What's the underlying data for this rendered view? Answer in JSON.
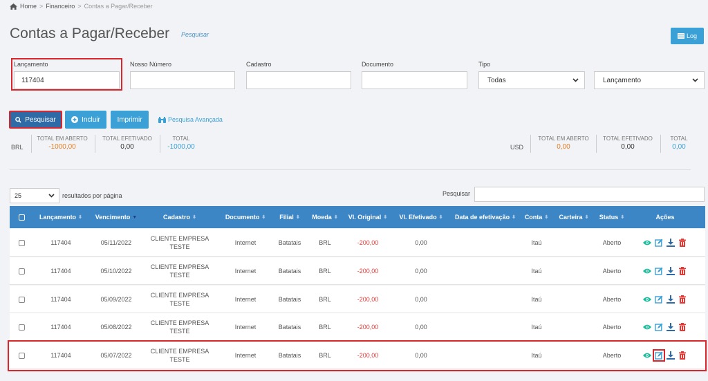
{
  "breadcrumb": {
    "home": "Home",
    "sep": ">",
    "item1": "Financeiro",
    "item2": "Contas a Pagar/Receber"
  },
  "header": {
    "title": "Contas a Pagar/Receber",
    "search_link": "Pesquisar",
    "log_button": "Log"
  },
  "filters": {
    "lancamento": {
      "label": "Lançamento",
      "value": "117404"
    },
    "nosso_numero": {
      "label": "Nosso Número",
      "value": ""
    },
    "cadastro": {
      "label": "Cadastro",
      "value": ""
    },
    "documento": {
      "label": "Documento",
      "value": ""
    },
    "tipo": {
      "label": "Tipo",
      "value": "Todas"
    },
    "order": {
      "value": "Lançamento"
    }
  },
  "buttons": {
    "search": "Pesquisar",
    "incluir": "Incluir",
    "imprimir": "Imprimir",
    "advanced": "Pesquisa Avançada"
  },
  "totals": {
    "brl": {
      "currency": "BRL",
      "open_label": "TOTAL EM ABERTO",
      "open": "-1000,00",
      "done_label": "TOTAL EFETIVADO",
      "done": "0,00",
      "total_label": "TOTAL",
      "total": "-1000,00"
    },
    "usd": {
      "currency": "USD",
      "open_label": "TOTAL EM ABERTO",
      "open": "0,00",
      "done_label": "TOTAL EFETIVADO",
      "done": "0,00",
      "total_label": "TOTAL",
      "total": "0,00"
    }
  },
  "table_controls": {
    "per_page": "25",
    "per_page_label": "resultados por página",
    "search_label": "Pesquisar"
  },
  "columns": [
    "Lançamento",
    "Vencimento",
    "Cadastro",
    "Documento",
    "Filial",
    "Moeda",
    "Vl. Original",
    "Vl. Efetivado",
    "Data de efetivação",
    "Conta",
    "Carteira",
    "Status",
    "Ações"
  ],
  "rows": [
    {
      "lancamento": "117404",
      "vencimento": "05/11/2022",
      "cadastro": "CLIENTE EMPRESA TESTE",
      "documento": "Internet",
      "filial": "Batatais",
      "moeda": "BRL",
      "original": "-200,00",
      "efetivado": "0,00",
      "data": "",
      "conta": "Itaú",
      "carteira": "",
      "status": "Aberto"
    },
    {
      "lancamento": "117404",
      "vencimento": "05/10/2022",
      "cadastro": "CLIENTE EMPRESA TESTE",
      "documento": "Internet",
      "filial": "Batatais",
      "moeda": "BRL",
      "original": "-200,00",
      "efetivado": "0,00",
      "data": "",
      "conta": "Itaú",
      "carteira": "",
      "status": "Aberto"
    },
    {
      "lancamento": "117404",
      "vencimento": "05/09/2022",
      "cadastro": "CLIENTE EMPRESA TESTE",
      "documento": "Internet",
      "filial": "Batatais",
      "moeda": "BRL",
      "original": "-200,00",
      "efetivado": "0,00",
      "data": "",
      "conta": "Itaú",
      "carteira": "",
      "status": "Aberto"
    },
    {
      "lancamento": "117404",
      "vencimento": "05/08/2022",
      "cadastro": "CLIENTE EMPRESA TESTE",
      "documento": "Internet",
      "filial": "Batatais",
      "moeda": "BRL",
      "original": "-200,00",
      "efetivado": "0,00",
      "data": "",
      "conta": "Itaú",
      "carteira": "",
      "status": "Aberto"
    },
    {
      "lancamento": "117404",
      "vencimento": "05/07/2022",
      "cadastro": "CLIENTE EMPRESA TESTE",
      "documento": "Internet",
      "filial": "Batatais",
      "moeda": "BRL",
      "original": "-200,00",
      "efetivado": "0,00",
      "data": "",
      "conta": "Itaú",
      "carteira": "",
      "status": "Aberto"
    }
  ],
  "icons": {
    "view": "eye-icon",
    "edit": "edit-icon",
    "download": "download-icon",
    "delete": "trash-icon"
  },
  "colors": {
    "primary": "#3aa0d5",
    "header": "#3d86c6",
    "highlight": "#d9252b",
    "negative": "#e53935",
    "open_total": "#e67e22"
  }
}
